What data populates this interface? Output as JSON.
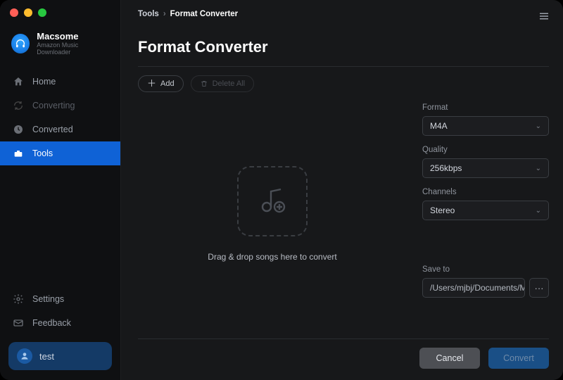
{
  "brand": {
    "name": "Macsome",
    "subtitle": "Amazon Music Downloader"
  },
  "sidebar": {
    "items": [
      {
        "label": "Home"
      },
      {
        "label": "Converting"
      },
      {
        "label": "Converted"
      },
      {
        "label": "Tools"
      }
    ],
    "settings": "Settings",
    "feedback": "Feedback"
  },
  "user": {
    "name": "test"
  },
  "breadcrumb": {
    "root": "Tools",
    "sep": "›",
    "leaf": "Format Converter"
  },
  "page": {
    "title": "Format Converter"
  },
  "toolbar": {
    "add_label": "Add",
    "delete_all_label": "Delete All"
  },
  "dropzone": {
    "hint": "Drag & drop songs here to convert"
  },
  "panel": {
    "format_label": "Format",
    "format_value": "M4A",
    "quality_label": "Quality",
    "quality_value": "256kbps",
    "channels_label": "Channels",
    "channels_value": "Stereo",
    "save_label": "Save to",
    "save_path": "/Users/mjbj/Documents/Ma",
    "browse_glyph": "···"
  },
  "footer": {
    "cancel": "Cancel",
    "convert": "Convert"
  }
}
